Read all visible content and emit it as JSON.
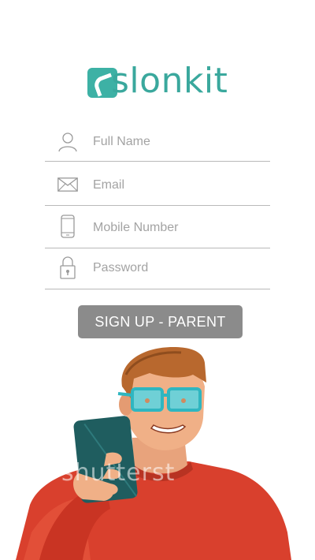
{
  "brand": {
    "name": "slonkit",
    "color": "#3db1a5"
  },
  "form": {
    "full_name": {
      "placeholder": "Full Name",
      "icon": "person-icon"
    },
    "email": {
      "placeholder": "Email",
      "icon": "envelope-icon"
    },
    "mobile": {
      "placeholder": "Mobile Number",
      "icon": "phone-icon"
    },
    "password": {
      "placeholder": "Password",
      "icon": "lock-icon"
    }
  },
  "signup_button": {
    "label": "SIGN UP - PARENT",
    "color": "#8b8b8b"
  },
  "illustration": {
    "watermark": "shutterst"
  }
}
